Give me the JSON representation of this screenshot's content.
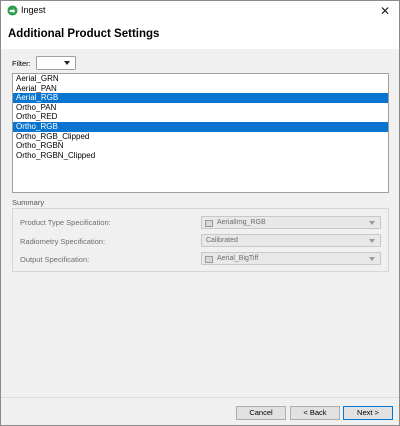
{
  "window": {
    "title": "Ingest",
    "close_glyph": "✕",
    "app_icon": "green-circle-arrow-icon",
    "accent_color": "#0a74d1"
  },
  "page": {
    "heading": "Additional Product Settings"
  },
  "filter": {
    "label": "Filter:",
    "value": ""
  },
  "product_list": {
    "items": [
      {
        "label": "Aerial_GRN",
        "selected": false
      },
      {
        "label": "Aerial_PAN",
        "selected": false
      },
      {
        "label": "Aerial_RGB",
        "selected": true
      },
      {
        "label": "Ortho_PAN",
        "selected": false
      },
      {
        "label": "Ortho_RED",
        "selected": false
      },
      {
        "label": "Ortho_RGB",
        "selected": true
      },
      {
        "label": "Ortho_RGB_Clipped",
        "selected": false
      },
      {
        "label": "Ortho_RGBN",
        "selected": false
      },
      {
        "label": "Ortho_RGBN_Clipped",
        "selected": false
      }
    ]
  },
  "summary": {
    "label": "Summary",
    "rows": [
      {
        "label": "Product Type Specification:",
        "value": "AerialImg_RGB",
        "has_icon": true
      },
      {
        "label": "Radiometry Specification:",
        "value": "Calibrated",
        "has_icon": false
      },
      {
        "label": "Output Specification:",
        "value": "Aerial_BigTiff",
        "has_icon": true
      }
    ]
  },
  "buttons": {
    "cancel": "Cancel",
    "back": "< Back",
    "next": "Next >"
  }
}
